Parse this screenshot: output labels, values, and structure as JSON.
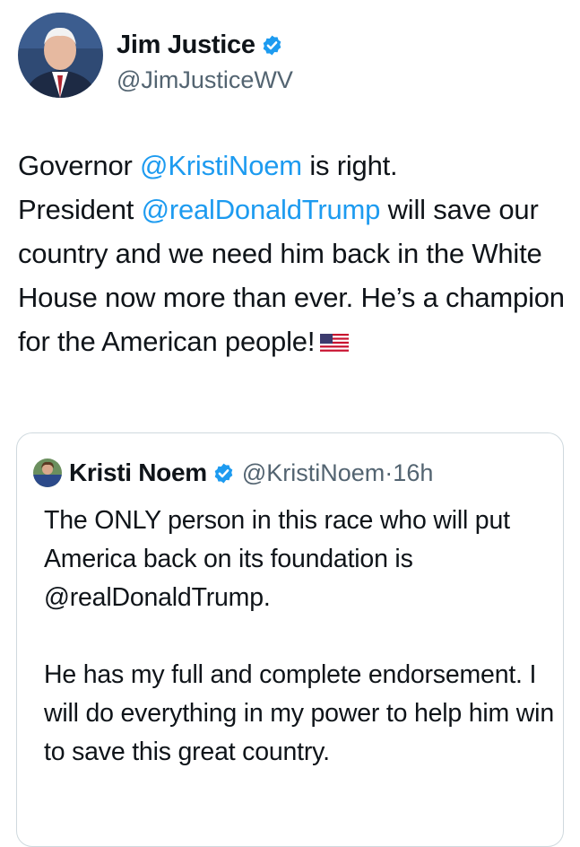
{
  "tweet": {
    "author": {
      "display_name": "Jim Justice",
      "handle": "@JimJusticeWV",
      "verified": true
    },
    "text": {
      "p1": "Governor ",
      "mention1": "@KristiNoem",
      "p2": " is right.",
      "p3": "President ",
      "mention2": "@realDonaldTrump",
      "p4": " will save our country and we need him back in the White House now more than ever. He’s a champion for the American people!"
    },
    "emoji": "us-flag"
  },
  "quoted_tweet": {
    "author": {
      "display_name": "Kristi Noem",
      "handle": "@KristiNoem",
      "separator": "·",
      "time": "16h",
      "verified": true
    },
    "paragraphs": [
      "The ONLY person in this race who will put America back on its foundation is @realDonaldTrump.",
      "He has my full and complete endorsement. I will do everything in my power to help him win to save this great country."
    ]
  },
  "colors": {
    "text": "#0f1419",
    "secondary": "#536471",
    "link": "#1d9bf0",
    "verified": "#1d9bf0",
    "border": "#cfd9de"
  }
}
